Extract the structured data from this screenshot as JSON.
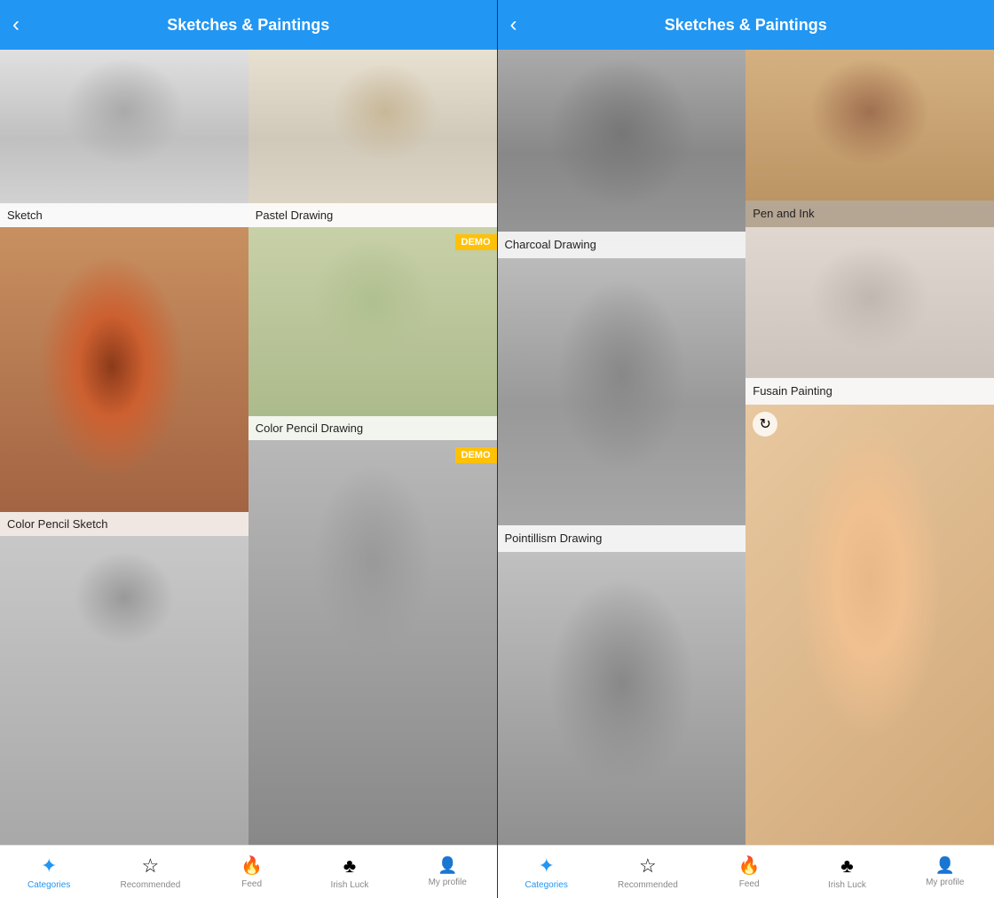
{
  "left_panel": {
    "header": {
      "title": "Sketches & Paintings",
      "back_label": "‹"
    },
    "items": [
      {
        "id": "sketch",
        "label": "Sketch",
        "demo": false
      },
      {
        "id": "pastel",
        "label": "Pastel Drawing",
        "demo": false
      },
      {
        "id": "color-pencil-sketch",
        "label": "Color Pencil Sketch",
        "demo": false
      },
      {
        "id": "color-pencil",
        "label": "Color Pencil Drawing",
        "demo": true
      },
      {
        "id": "bottom-left",
        "label": "",
        "demo": false
      },
      {
        "id": "bottom-right",
        "label": "",
        "demo": true
      }
    ],
    "nav": {
      "categories": "Categories",
      "recommended": "Recommended",
      "feed": "Feed",
      "irish_luck": "Irish Luck",
      "my_profile": "My profile"
    }
  },
  "right_panel": {
    "header": {
      "title": "Sketches & Paintings",
      "back_label": "‹"
    },
    "items": [
      {
        "id": "charcoal",
        "label": "Charcoal Drawing",
        "demo": false
      },
      {
        "id": "pen-ink",
        "label": "Pen and Ink",
        "demo": false
      },
      {
        "id": "pointillism",
        "label": "Pointillism Drawing",
        "demo": false
      },
      {
        "id": "fusain",
        "label": "Fusain Painting",
        "demo": false
      },
      {
        "id": "bottom-sketch",
        "label": "",
        "demo": false
      },
      {
        "id": "colorful",
        "label": "",
        "demo": false
      }
    ]
  },
  "demo_badge": "DEMO",
  "icons": {
    "back": "‹",
    "categories": "✦",
    "recommended": "☆",
    "feed": "🔥",
    "irish_luck": "♣",
    "my_profile": "👤",
    "spin": "↻"
  }
}
